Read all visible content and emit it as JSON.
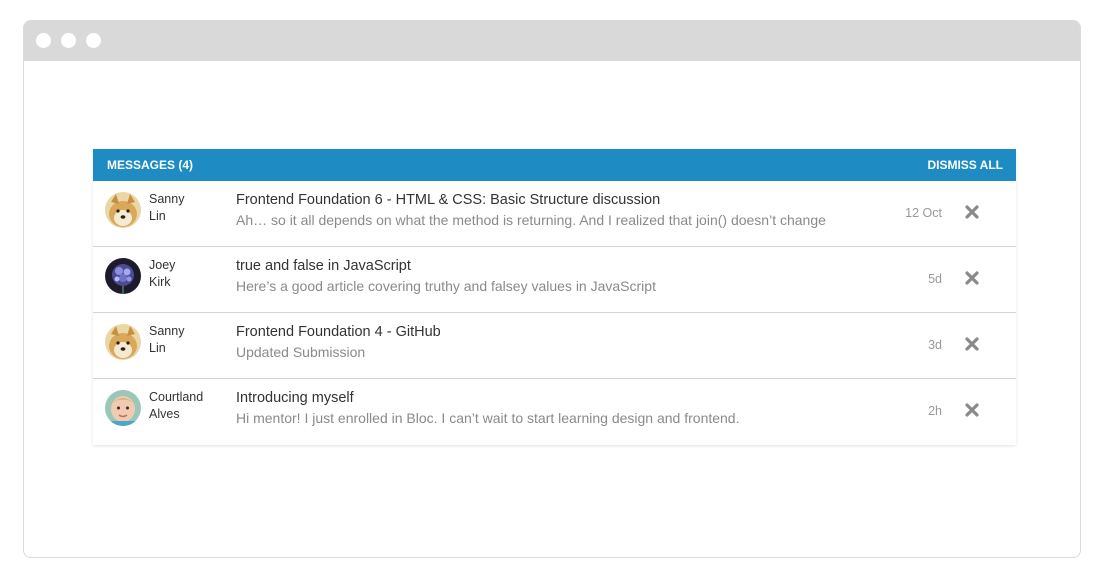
{
  "header": {
    "title": "MESSAGES (4)",
    "dismiss_label": "DISMISS ALL"
  },
  "colors": {
    "header_bg": "#1e8bc3",
    "titlebar_bg": "#d9d9d9"
  },
  "messages": [
    {
      "first_name": "Sanny",
      "last_name": "Lin",
      "avatar": "doge-avatar",
      "subject": "Frontend Foundation 6 - HTML & CSS: Basic Structure discussion",
      "preview": "Ah… so it all depends on what the method is returning. And I realized that join() doesn’t change",
      "time": "12 Oct",
      "close_icon": "close-x-icon"
    },
    {
      "first_name": "Joey",
      "last_name": "Kirk",
      "avatar": "flower-avatar",
      "subject": "true and false in JavaScript",
      "preview": "Here’s a good article covering truthy and falsey values in JavaScript",
      "time": "5d",
      "close_icon": "close-x-icon"
    },
    {
      "first_name": "Sanny",
      "last_name": "Lin",
      "avatar": "doge-avatar",
      "subject": "Frontend Foundation 4 - GitHub",
      "preview": "Updated Submission",
      "time": "3d",
      "close_icon": "close-x-icon"
    },
    {
      "first_name": "Courtland",
      "last_name": "Alves",
      "avatar": "baby-avatar",
      "subject": "Introducing myself",
      "preview": "Hi mentor! I just enrolled in Bloc. I can’t wait to start learning design and frontend.",
      "time": "2h",
      "close_icon": "close-x-icon"
    }
  ]
}
